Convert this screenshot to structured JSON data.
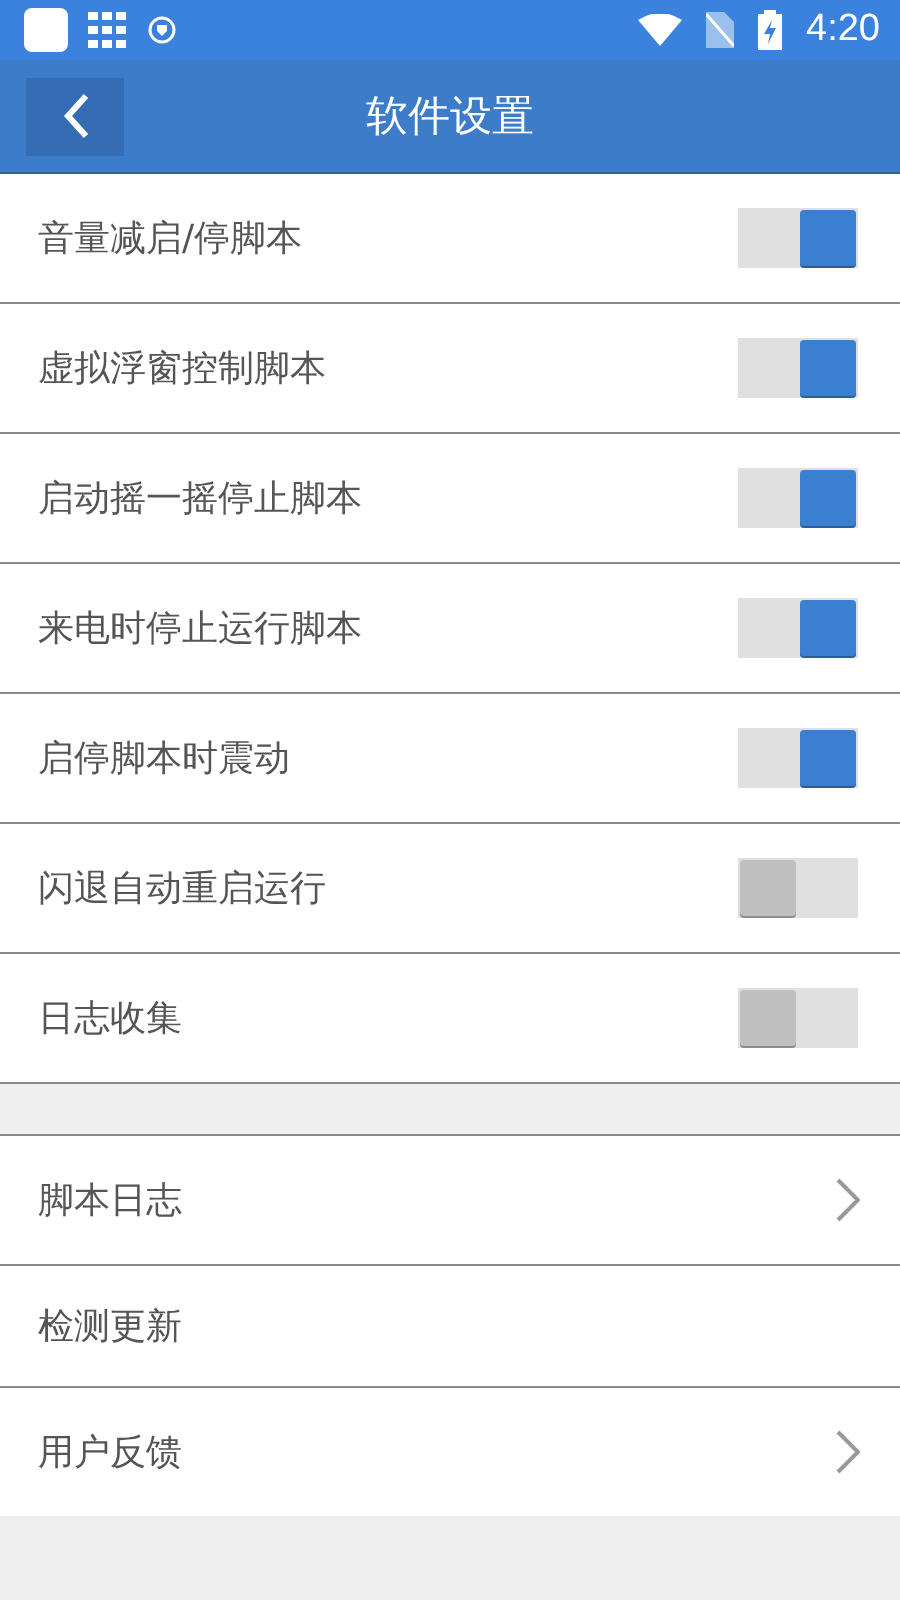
{
  "status_bar": {
    "time": "4:20"
  },
  "header": {
    "title": "软件设置"
  },
  "toggles": [
    {
      "label": "音量减启/停脚本",
      "on": true
    },
    {
      "label": "虚拟浮窗控制脚本",
      "on": true
    },
    {
      "label": "启动摇一摇停止脚本",
      "on": true
    },
    {
      "label": "来电时停止运行脚本",
      "on": true
    },
    {
      "label": "启停脚本时震动",
      "on": true
    },
    {
      "label": "闪退自动重启运行",
      "on": false
    },
    {
      "label": "日志收集",
      "on": false
    }
  ],
  "links": [
    {
      "label": "脚本日志",
      "arrow": true
    },
    {
      "label": "检测更新",
      "arrow": false
    },
    {
      "label": "用户反馈",
      "arrow": true
    }
  ]
}
